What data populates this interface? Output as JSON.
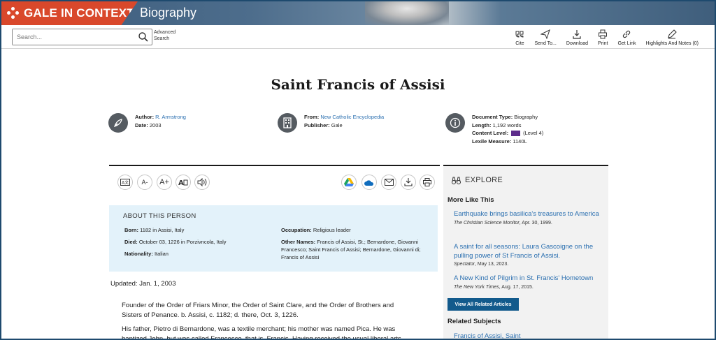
{
  "header": {
    "brand": "GALE IN CONTEXT",
    "product": "Biography",
    "brand_color": "#d9482b"
  },
  "toolbar": {
    "search_placeholder": "Search...",
    "advanced_search": [
      "Advanced",
      "Search"
    ],
    "tools": [
      {
        "label": "Cite",
        "icon": "quote-icon"
      },
      {
        "label": "Send To...",
        "icon": "send-icon"
      },
      {
        "label": "Download",
        "icon": "download-icon"
      },
      {
        "label": "Print",
        "icon": "print-icon"
      },
      {
        "label": "Get Link",
        "icon": "link-icon"
      },
      {
        "label": "Highlights And Notes (0)",
        "icon": "pen-icon"
      }
    ]
  },
  "document": {
    "title": "Saint Francis of Assisi",
    "author_label": "Author:",
    "author": "R. Armstrong",
    "date_label": "Date:",
    "date": "2003",
    "from_label": "From:",
    "from": "New Catholic Encyclopedia",
    "publisher_label": "Publisher:",
    "publisher": "Gale",
    "doctype_label": "Document Type:",
    "doctype": "Biography",
    "length_label": "Length:",
    "length": "1,192 words",
    "content_level_label": "Content Level:",
    "content_level": "(Level 4)",
    "lexile_label": "Lexile Measure:",
    "lexile": "1140L"
  },
  "article_tools": {
    "text_size_down": "A-",
    "text_size_up": "A+"
  },
  "about": {
    "heading": "ABOUT THIS PERSON",
    "born_label": "Born:",
    "born": "1182 in Assisi, Italy",
    "died_label": "Died:",
    "died": "October 03, 1226 in Porzivncola, Italy",
    "nationality_label": "Nationality:",
    "nationality": "Italian",
    "occupation_label": "Occupation:",
    "occupation": "Religious leader",
    "other_names_label": "Other Names:",
    "other_names": "Francis of Assisi, St.; Bernardone, Giovanni Francesco; Saint Francis of Assisi; Bernardone, Giovanni di; Francis of Assisi"
  },
  "body": {
    "updated": "Updated: Jan. 1, 2003",
    "paragraph1": "Founder of the Order of Friars Minor, the Order of Saint Clare, and the Order of Brothers and Sisters of Penance. b. Assisi, c. 1182; d. there, Oct. 3, 1226.",
    "paragraph2": "His father, Pietro di Bernardone, was a textile merchant; his mother was named Pica. He was baptized John, but was called Francesco, that is, Francis. Having received the usual liberal arts"
  },
  "sidebar": {
    "explore": "EXPLORE",
    "more_like_this": "More Like This",
    "articles": [
      {
        "title": "Earthquake brings basilica's treasures to America",
        "source": "The Christian Science Monitor",
        "date": ", Apr. 30, 1999."
      },
      {
        "title": "A saint for all seasons: Laura Gascoigne on the pulling power of St Francis of Assisi.",
        "source": "Spectator",
        "date": ", May 13, 2023."
      },
      {
        "title": "A New Kind of Pilgrim in St. Francis' Hometown",
        "source": "The New York Times",
        "date": ", Aug. 17, 2015."
      }
    ],
    "view_all": "View All Related Articles",
    "related_subjects": "Related Subjects",
    "subjects": [
      "Francis of Assisi, Saint"
    ]
  }
}
